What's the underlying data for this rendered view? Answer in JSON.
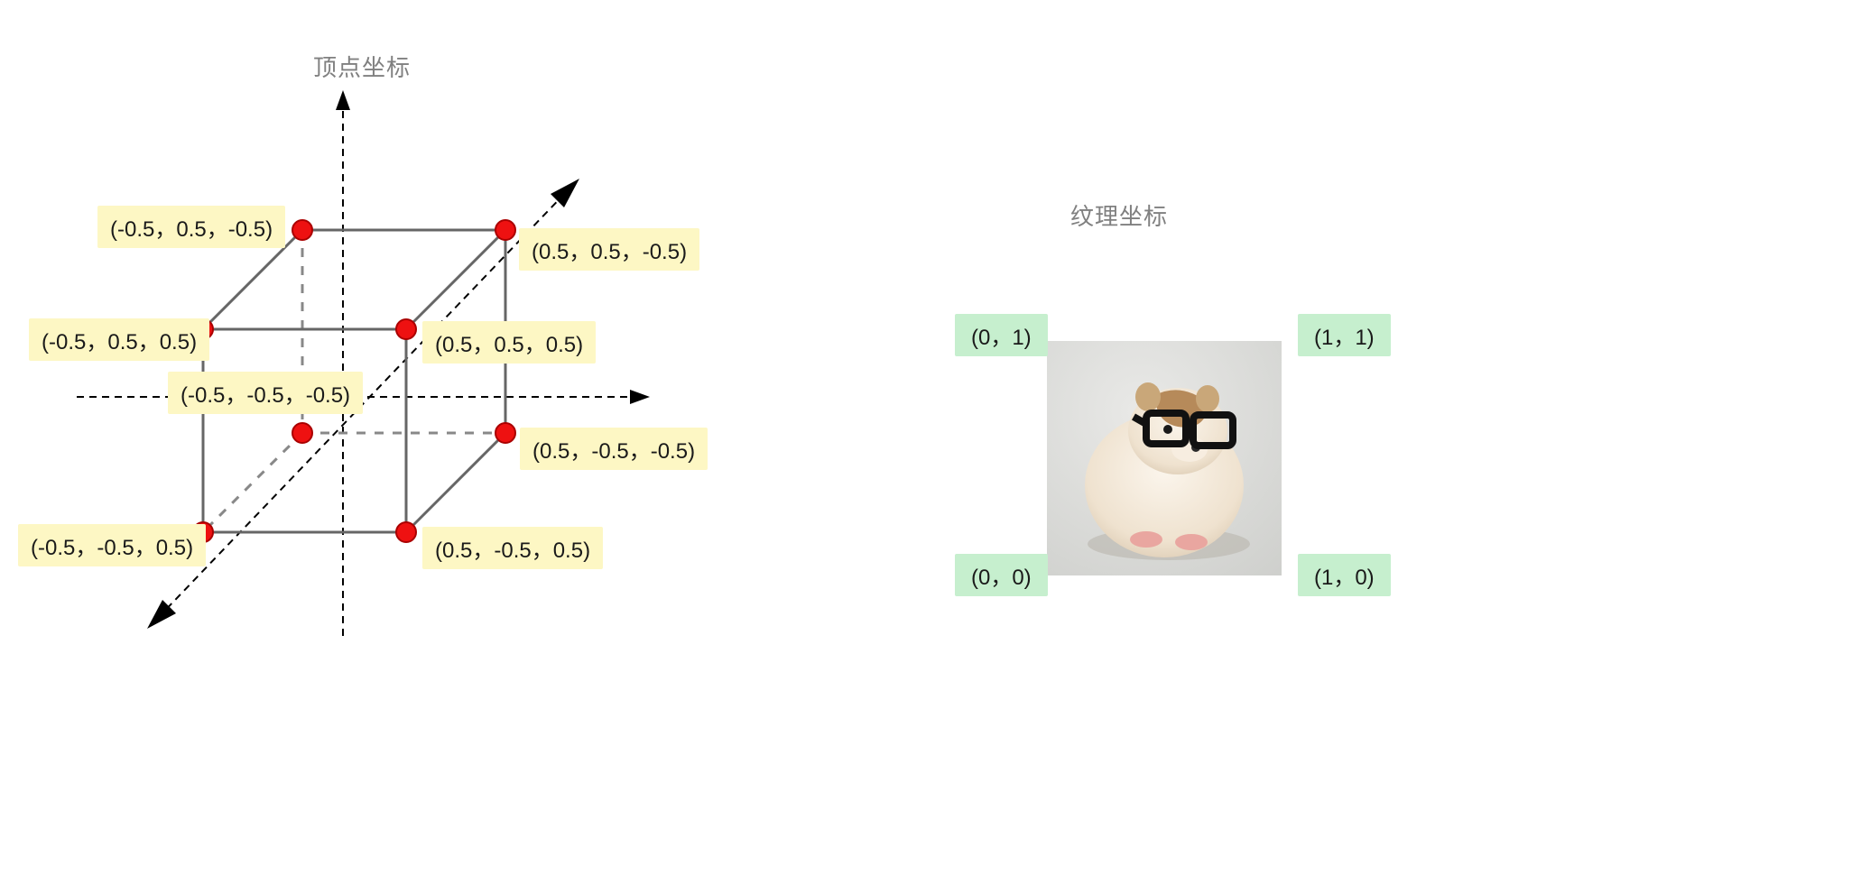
{
  "titles": {
    "vertices": "顶点坐标",
    "texture": "纹理坐标"
  },
  "vertices": {
    "back_top_left": "(-0.5，0.5，-0.5)",
    "back_top_right": "(0.5，0.5，-0.5)",
    "front_top_left": "(-0.5，0.5，0.5)",
    "front_top_right": "(0.5，0.5，0.5)",
    "back_bot_left": "(-0.5，-0.5，-0.5)",
    "back_bot_right": "(0.5，-0.5，-0.5)",
    "front_bot_left": "(-0.5，-0.5，0.5)",
    "front_bot_right": "(0.5，-0.5，0.5)"
  },
  "texcoords": {
    "tl": "(0，1)",
    "tr": "(1，1)",
    "bl": "(0，0)",
    "br": "(1，0)"
  },
  "chart_data": {
    "type": "diagram",
    "left": {
      "kind": "cube-vertices",
      "axes": [
        "x",
        "y",
        "z"
      ],
      "vertices": [
        {
          "label": "(-0.5，0.5，-0.5)",
          "x": -0.5,
          "y": 0.5,
          "z": -0.5
        },
        {
          "label": "(0.5，0.5，-0.5)",
          "x": 0.5,
          "y": 0.5,
          "z": -0.5
        },
        {
          "label": "(-0.5，0.5，0.5)",
          "x": -0.5,
          "y": 0.5,
          "z": 0.5
        },
        {
          "label": "(0.5，0.5，0.5)",
          "x": 0.5,
          "y": 0.5,
          "z": 0.5
        },
        {
          "label": "(-0.5，-0.5，-0.5)",
          "x": -0.5,
          "y": -0.5,
          "z": -0.5
        },
        {
          "label": "(0.5，-0.5，-0.5)",
          "x": 0.5,
          "y": -0.5,
          "z": -0.5
        },
        {
          "label": "(-0.5，-0.5，0.5)",
          "x": -0.5,
          "y": -0.5,
          "z": 0.5
        },
        {
          "label": "(0.5，-0.5，0.5)",
          "x": 0.5,
          "y": -0.5,
          "z": 0.5
        }
      ]
    },
    "right": {
      "kind": "uv-square",
      "corners": [
        {
          "label": "(0，1)",
          "u": 0,
          "v": 1
        },
        {
          "label": "(1，1)",
          "u": 1,
          "v": 1
        },
        {
          "label": "(0，0)",
          "u": 0,
          "v": 0
        },
        {
          "label": "(1，0)",
          "u": 1,
          "v": 0
        }
      ]
    }
  }
}
